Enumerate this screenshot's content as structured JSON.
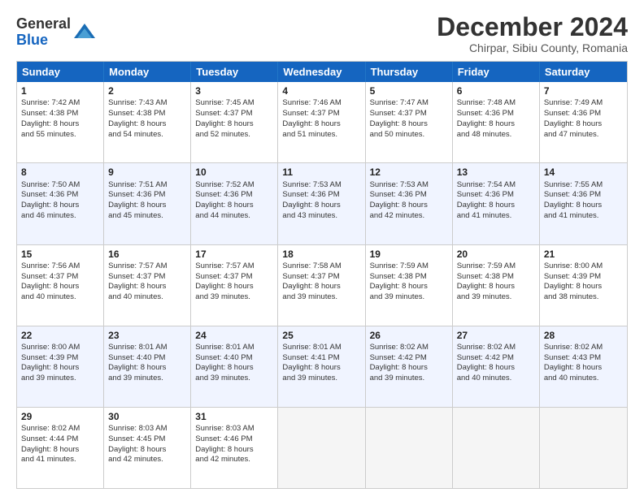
{
  "header": {
    "logo_general": "General",
    "logo_blue": "Blue",
    "month_title": "December 2024",
    "location": "Chirpar, Sibiu County, Romania"
  },
  "days_of_week": [
    "Sunday",
    "Monday",
    "Tuesday",
    "Wednesday",
    "Thursday",
    "Friday",
    "Saturday"
  ],
  "rows": [
    [
      {
        "day": "1",
        "lines": [
          "Sunrise: 7:42 AM",
          "Sunset: 4:38 PM",
          "Daylight: 8 hours",
          "and 55 minutes."
        ]
      },
      {
        "day": "2",
        "lines": [
          "Sunrise: 7:43 AM",
          "Sunset: 4:38 PM",
          "Daylight: 8 hours",
          "and 54 minutes."
        ]
      },
      {
        "day": "3",
        "lines": [
          "Sunrise: 7:45 AM",
          "Sunset: 4:37 PM",
          "Daylight: 8 hours",
          "and 52 minutes."
        ]
      },
      {
        "day": "4",
        "lines": [
          "Sunrise: 7:46 AM",
          "Sunset: 4:37 PM",
          "Daylight: 8 hours",
          "and 51 minutes."
        ]
      },
      {
        "day": "5",
        "lines": [
          "Sunrise: 7:47 AM",
          "Sunset: 4:37 PM",
          "Daylight: 8 hours",
          "and 50 minutes."
        ]
      },
      {
        "day": "6",
        "lines": [
          "Sunrise: 7:48 AM",
          "Sunset: 4:36 PM",
          "Daylight: 8 hours",
          "and 48 minutes."
        ]
      },
      {
        "day": "7",
        "lines": [
          "Sunrise: 7:49 AM",
          "Sunset: 4:36 PM",
          "Daylight: 8 hours",
          "and 47 minutes."
        ]
      }
    ],
    [
      {
        "day": "8",
        "lines": [
          "Sunrise: 7:50 AM",
          "Sunset: 4:36 PM",
          "Daylight: 8 hours",
          "and 46 minutes."
        ]
      },
      {
        "day": "9",
        "lines": [
          "Sunrise: 7:51 AM",
          "Sunset: 4:36 PM",
          "Daylight: 8 hours",
          "and 45 minutes."
        ]
      },
      {
        "day": "10",
        "lines": [
          "Sunrise: 7:52 AM",
          "Sunset: 4:36 PM",
          "Daylight: 8 hours",
          "and 44 minutes."
        ]
      },
      {
        "day": "11",
        "lines": [
          "Sunrise: 7:53 AM",
          "Sunset: 4:36 PM",
          "Daylight: 8 hours",
          "and 43 minutes."
        ]
      },
      {
        "day": "12",
        "lines": [
          "Sunrise: 7:53 AM",
          "Sunset: 4:36 PM",
          "Daylight: 8 hours",
          "and 42 minutes."
        ]
      },
      {
        "day": "13",
        "lines": [
          "Sunrise: 7:54 AM",
          "Sunset: 4:36 PM",
          "Daylight: 8 hours",
          "and 41 minutes."
        ]
      },
      {
        "day": "14",
        "lines": [
          "Sunrise: 7:55 AM",
          "Sunset: 4:36 PM",
          "Daylight: 8 hours",
          "and 41 minutes."
        ]
      }
    ],
    [
      {
        "day": "15",
        "lines": [
          "Sunrise: 7:56 AM",
          "Sunset: 4:37 PM",
          "Daylight: 8 hours",
          "and 40 minutes."
        ]
      },
      {
        "day": "16",
        "lines": [
          "Sunrise: 7:57 AM",
          "Sunset: 4:37 PM",
          "Daylight: 8 hours",
          "and 40 minutes."
        ]
      },
      {
        "day": "17",
        "lines": [
          "Sunrise: 7:57 AM",
          "Sunset: 4:37 PM",
          "Daylight: 8 hours",
          "and 39 minutes."
        ]
      },
      {
        "day": "18",
        "lines": [
          "Sunrise: 7:58 AM",
          "Sunset: 4:37 PM",
          "Daylight: 8 hours",
          "and 39 minutes."
        ]
      },
      {
        "day": "19",
        "lines": [
          "Sunrise: 7:59 AM",
          "Sunset: 4:38 PM",
          "Daylight: 8 hours",
          "and 39 minutes."
        ]
      },
      {
        "day": "20",
        "lines": [
          "Sunrise: 7:59 AM",
          "Sunset: 4:38 PM",
          "Daylight: 8 hours",
          "and 39 minutes."
        ]
      },
      {
        "day": "21",
        "lines": [
          "Sunrise: 8:00 AM",
          "Sunset: 4:39 PM",
          "Daylight: 8 hours",
          "and 38 minutes."
        ]
      }
    ],
    [
      {
        "day": "22",
        "lines": [
          "Sunrise: 8:00 AM",
          "Sunset: 4:39 PM",
          "Daylight: 8 hours",
          "and 39 minutes."
        ]
      },
      {
        "day": "23",
        "lines": [
          "Sunrise: 8:01 AM",
          "Sunset: 4:40 PM",
          "Daylight: 8 hours",
          "and 39 minutes."
        ]
      },
      {
        "day": "24",
        "lines": [
          "Sunrise: 8:01 AM",
          "Sunset: 4:40 PM",
          "Daylight: 8 hours",
          "and 39 minutes."
        ]
      },
      {
        "day": "25",
        "lines": [
          "Sunrise: 8:01 AM",
          "Sunset: 4:41 PM",
          "Daylight: 8 hours",
          "and 39 minutes."
        ]
      },
      {
        "day": "26",
        "lines": [
          "Sunrise: 8:02 AM",
          "Sunset: 4:42 PM",
          "Daylight: 8 hours",
          "and 39 minutes."
        ]
      },
      {
        "day": "27",
        "lines": [
          "Sunrise: 8:02 AM",
          "Sunset: 4:42 PM",
          "Daylight: 8 hours",
          "and 40 minutes."
        ]
      },
      {
        "day": "28",
        "lines": [
          "Sunrise: 8:02 AM",
          "Sunset: 4:43 PM",
          "Daylight: 8 hours",
          "and 40 minutes."
        ]
      }
    ],
    [
      {
        "day": "29",
        "lines": [
          "Sunrise: 8:02 AM",
          "Sunset: 4:44 PM",
          "Daylight: 8 hours",
          "and 41 minutes."
        ]
      },
      {
        "day": "30",
        "lines": [
          "Sunrise: 8:03 AM",
          "Sunset: 4:45 PM",
          "Daylight: 8 hours",
          "and 42 minutes."
        ]
      },
      {
        "day": "31",
        "lines": [
          "Sunrise: 8:03 AM",
          "Sunset: 4:46 PM",
          "Daylight: 8 hours",
          "and 42 minutes."
        ]
      },
      null,
      null,
      null,
      null
    ]
  ]
}
